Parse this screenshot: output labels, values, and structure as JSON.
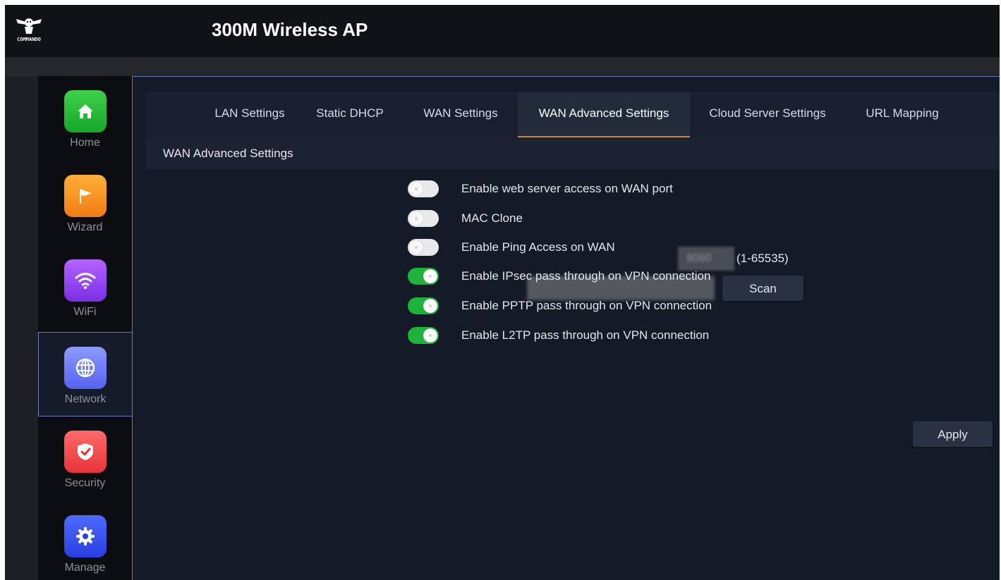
{
  "header": {
    "logo_text": "COMMANDO",
    "title": "300M Wireless AP"
  },
  "sidebar": {
    "items": [
      {
        "label": "Home",
        "icon": "home-icon",
        "color": "#16a62a"
      },
      {
        "label": "Wizard",
        "icon": "flag-icon",
        "color": "#f07c12"
      },
      {
        "label": "WiFi",
        "icon": "wifi-icon",
        "color": "#7a2fe6"
      },
      {
        "label": "Network",
        "icon": "globe-icon",
        "color": "#5662ee",
        "active": true
      },
      {
        "label": "Security",
        "icon": "shield-icon",
        "color": "#e7343a"
      },
      {
        "label": "Manage",
        "icon": "gear-icon",
        "color": "#2a3ee0"
      }
    ]
  },
  "tabs": [
    {
      "label": "LAN Settings"
    },
    {
      "label": "Static DHCP"
    },
    {
      "label": "WAN Settings"
    },
    {
      "label": "WAN Advanced Settings",
      "active": true
    },
    {
      "label": "Cloud Server Settings"
    },
    {
      "label": "URL Mapping"
    }
  ],
  "section": {
    "title": "WAN Advanced Settings"
  },
  "settings": {
    "web_server": {
      "label": "Enable web server access on WAN port",
      "enabled": false,
      "port_value": "8080",
      "range": "(1-65535)"
    },
    "mac_clone": {
      "label": "MAC Clone",
      "enabled": false,
      "scan_label": "Scan"
    },
    "ping": {
      "label": "Enable Ping Access on WAN",
      "enabled": false
    },
    "ipsec": {
      "label": "Enable IPsec pass through on VPN connection",
      "enabled": true
    },
    "pptp": {
      "label": "Enable PPTP pass through on VPN connection",
      "enabled": true
    },
    "l2tp": {
      "label": "Enable L2TP pass through on VPN connection",
      "enabled": true
    }
  },
  "actions": {
    "apply_label": "Apply"
  },
  "colors": {
    "accent_tab_underline": "#c58a3a",
    "toggle_on": "#1fb23a",
    "active_border": "#6b78c4"
  }
}
